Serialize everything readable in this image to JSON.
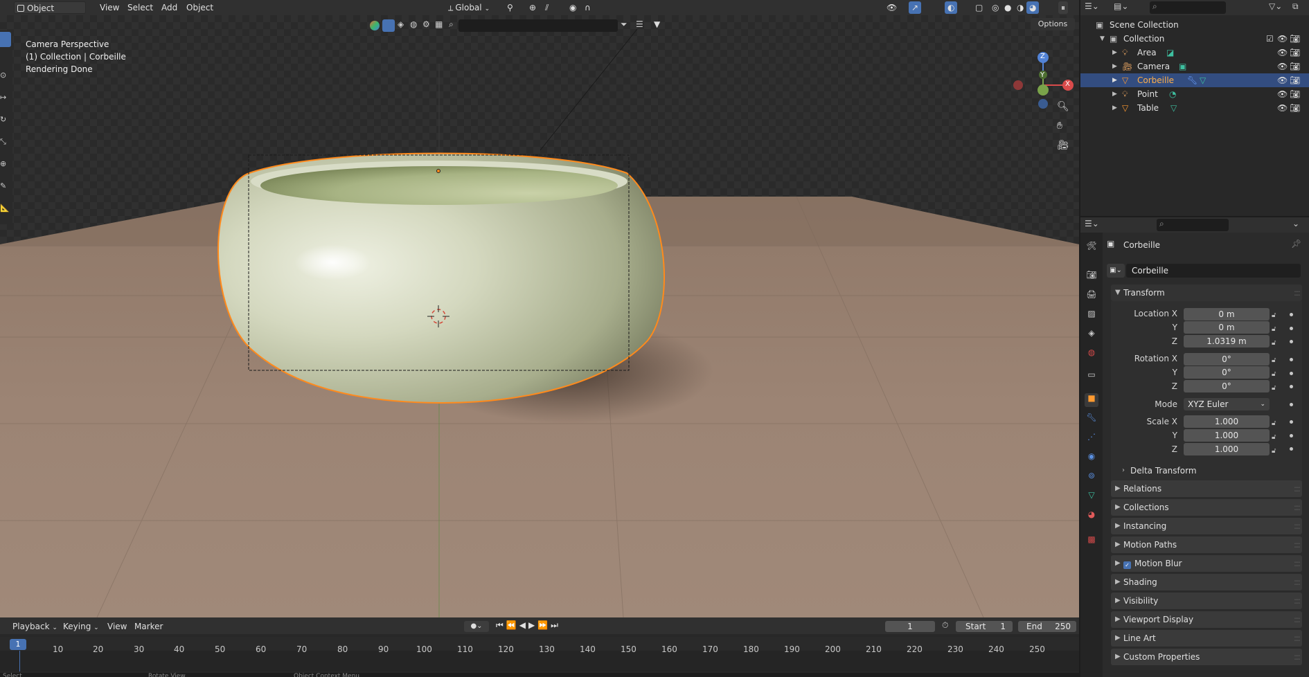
{
  "header": {
    "mode": "Object Mode",
    "menus": [
      "View",
      "Select",
      "Add",
      "Object"
    ],
    "orientation": "Global",
    "options": "Options"
  },
  "viewport": {
    "overlay_lines": [
      "Camera Perspective",
      "(1) Collection | Corbeille",
      "Rendering Done"
    ],
    "gizmo": {
      "x": "X",
      "y": "Y",
      "z": "Z"
    }
  },
  "outliner": {
    "root": "Scene Collection",
    "collection": "Collection",
    "items": [
      {
        "name": "Area",
        "icon": "light-icon",
        "selected": false
      },
      {
        "name": "Camera",
        "icon": "camera-icon",
        "selected": false
      },
      {
        "name": "Corbeille",
        "icon": "mesh-icon",
        "selected": true
      },
      {
        "name": "Point",
        "icon": "light-icon",
        "selected": false
      },
      {
        "name": "Table",
        "icon": "mesh-icon",
        "selected": false
      }
    ]
  },
  "properties": {
    "object_name": "Corbeille",
    "datablock_name": "Corbeille",
    "transform_title": "Transform",
    "location_label": "Location X",
    "location": [
      "0 m",
      "0 m",
      "1.0319 m"
    ],
    "rotation_label": "Rotation X",
    "rotation": [
      "0°",
      "0°",
      "0°"
    ],
    "mode_label": "Mode",
    "mode_value": "XYZ Euler",
    "scale_label": "Scale X",
    "scale": [
      "1.000",
      "1.000",
      "1.000"
    ],
    "axis_y": "Y",
    "axis_z": "Z",
    "delta_transform": "Delta Transform",
    "panels": [
      "Relations",
      "Collections",
      "Instancing",
      "Motion Paths",
      "Motion Blur",
      "Shading",
      "Visibility",
      "Viewport Display",
      "Line Art",
      "Custom Properties"
    ]
  },
  "timeline": {
    "menus": [
      "Playback",
      "Keying",
      "View",
      "Marker"
    ],
    "current_frame": "1",
    "start_label": "Start",
    "start": "1",
    "end_label": "End",
    "end": "250",
    "ruler": [
      "1",
      "10",
      "20",
      "30",
      "40",
      "50",
      "60",
      "70",
      "80",
      "90",
      "100",
      "110",
      "120",
      "130",
      "140",
      "150",
      "160",
      "170",
      "180",
      "190",
      "200",
      "210",
      "220",
      "230",
      "240",
      "250"
    ]
  },
  "status_bar": [
    "Select",
    "Rotate View",
    "Object Context Menu"
  ],
  "colors": {
    "accent": "#4772b3",
    "selection": "#ff8a1c",
    "selected_row": "#334d80"
  }
}
